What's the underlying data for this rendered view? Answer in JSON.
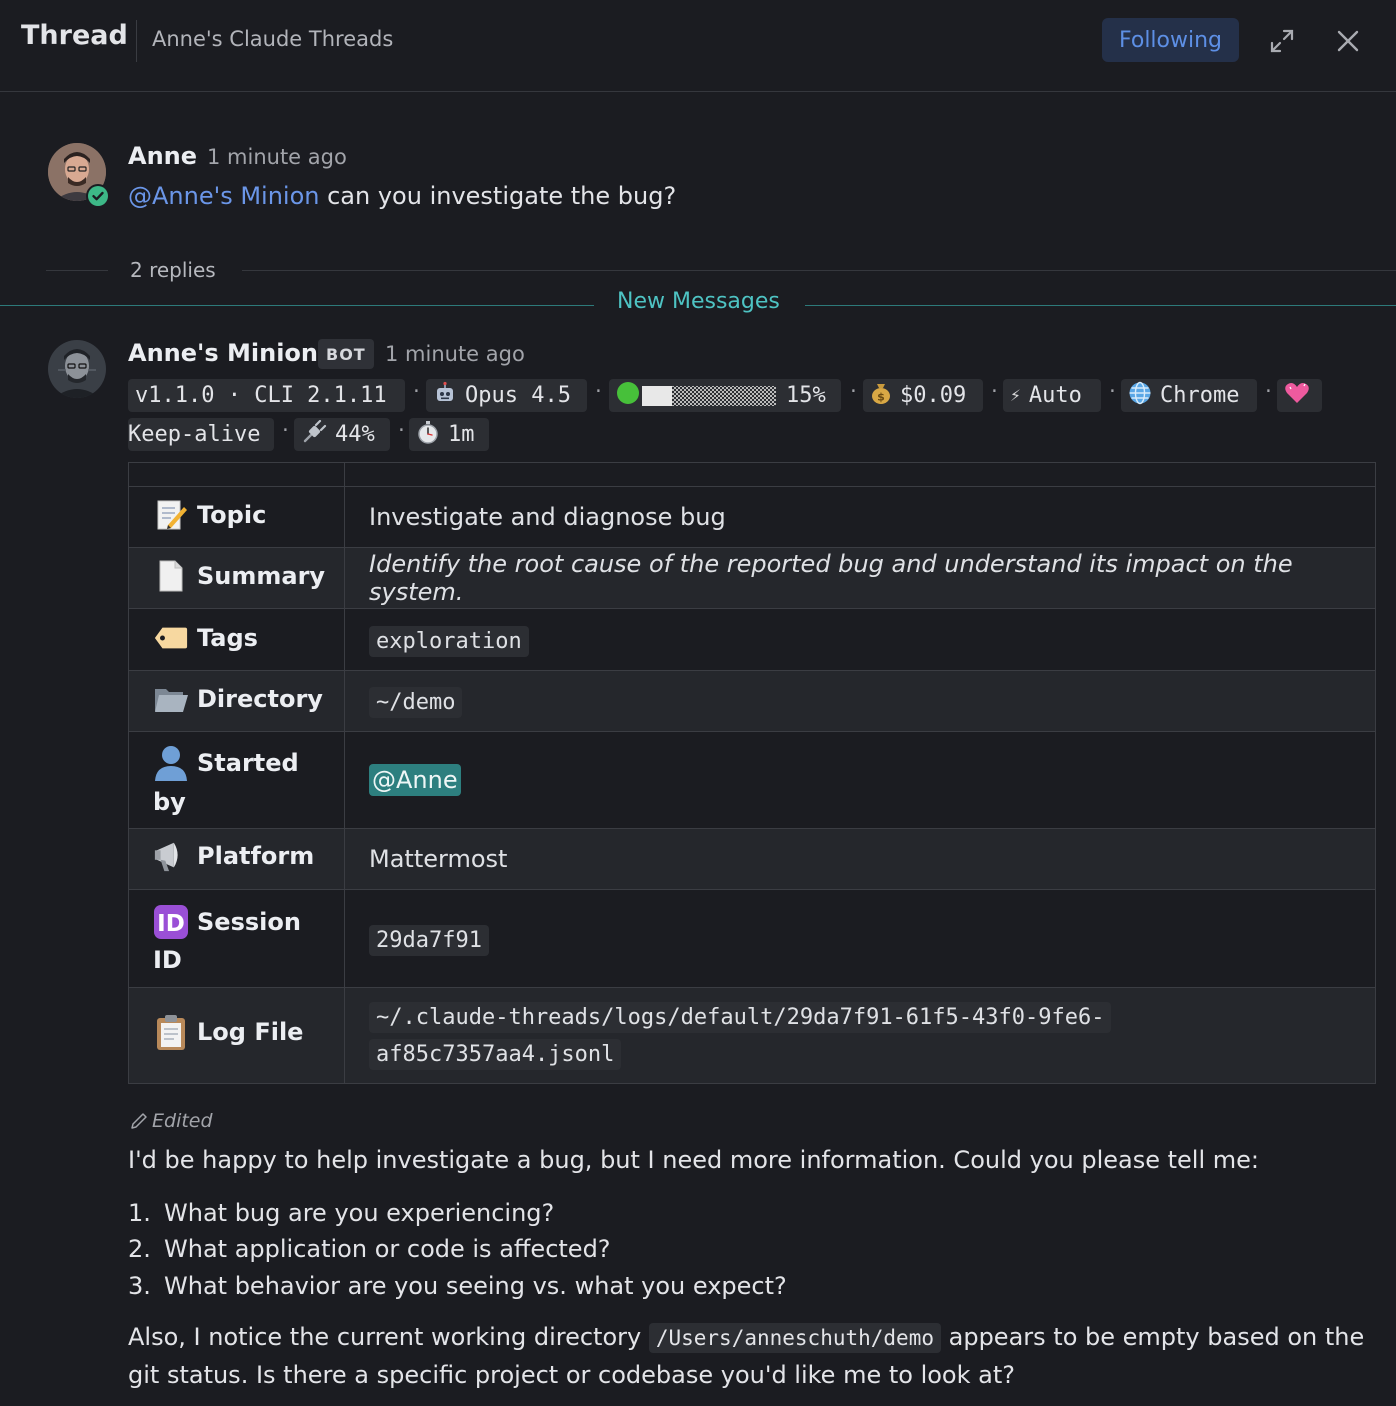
{
  "header": {
    "title": "Thread",
    "channel": "Anne's Claude Threads",
    "following_label": "Following"
  },
  "root_post": {
    "author": "Anne",
    "time": "1 minute ago",
    "mention": "@Anne's Minion",
    "text": " can you investigate the bug?"
  },
  "thread": {
    "replies_label": "2 replies",
    "new_messages_label": "New Messages"
  },
  "bot_post": {
    "author": "Anne's Minion",
    "badge": "BOT",
    "time": "1 minute ago",
    "status": {
      "version": "v1.1.0 · CLI 2.1.11",
      "model": "Opus 4.5",
      "context_percent": "15%",
      "cost": "$0.09",
      "mode": "Auto",
      "browser": "Chrome",
      "keepalive": "Keep-alive",
      "battery": "44%",
      "uptime": "1m"
    },
    "table": {
      "topic_label": "Topic",
      "topic_value": "Investigate and diagnose bug",
      "summary_label": "Summary",
      "summary_value": "Identify the root cause of the reported bug and understand its impact on the system.",
      "tags_label": "Tags",
      "tags_value": "exploration",
      "directory_label": "Directory",
      "directory_value": "~/demo",
      "started_label_1": "Started",
      "started_label_2": "by",
      "started_value": "@Anne",
      "platform_label": "Platform",
      "platform_value": "Mattermost",
      "session_label_1": "Session",
      "session_label_2": "ID",
      "session_value": "29da7f91",
      "log_label": "Log File",
      "log_value_1": "~/.claude-threads/logs/default/29da7f91-61f5-43f0-9fe6-",
      "log_value_2": "af85c7357aa4.jsonl"
    },
    "edited_label": "Edited",
    "intro": "I'd be happy to help investigate a bug, but I need more information. Could you please tell me:",
    "questions": [
      {
        "num": "1.",
        "text": "What bug are you experiencing?"
      },
      {
        "num": "2.",
        "text": "What application or code is affected?"
      },
      {
        "num": "3.",
        "text": "What behavior are you seeing vs. what you expect?"
      }
    ],
    "outro_1a": "Also, I notice the current working directory ",
    "outro_code": "/Users/anneschuth/demo",
    "outro_1b": " appears to be empty based on the",
    "outro_2": "git status. Is there a specific project or codebase you'd like me to look at?"
  },
  "colors": {
    "background": "#1b1c21",
    "mention": "#6b96e8",
    "new_messages": "#4ec3c3",
    "following": "#5d8fe5"
  }
}
